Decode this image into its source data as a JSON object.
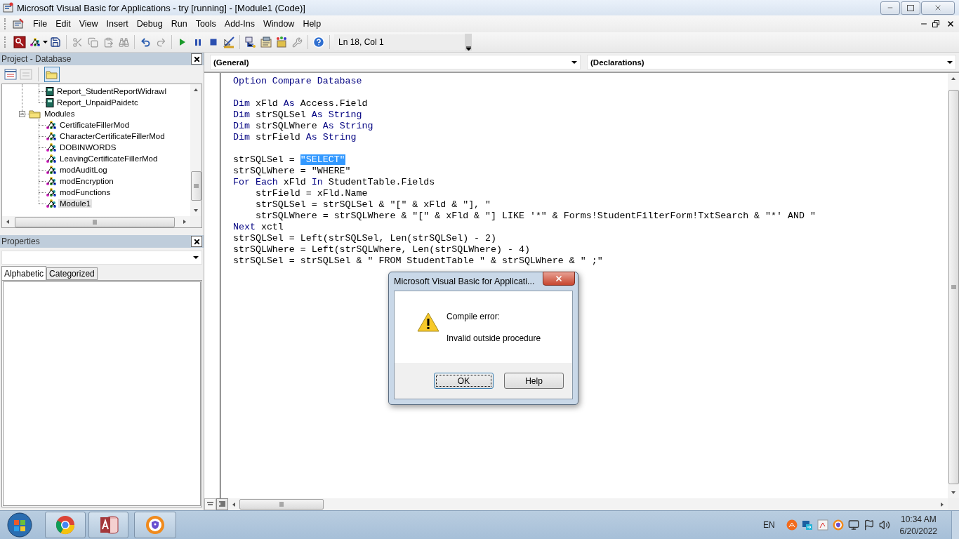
{
  "window": {
    "title": "Microsoft Visual Basic for Applications - try [running] - [Module1 (Code)]"
  },
  "menu": [
    "File",
    "Edit",
    "View",
    "Insert",
    "Debug",
    "Run",
    "Tools",
    "Add-Ins",
    "Window",
    "Help"
  ],
  "toolbar": {
    "position": "Ln 18, Col 1"
  },
  "project_panel": {
    "title": "Project - Database",
    "tree": [
      {
        "kind": "hidden_folder",
        "children": [
          {
            "label": "Report_StudentReportWidrawl",
            "kind": "report",
            "selected": false
          },
          {
            "label": "Report_UnpaidPaidetc",
            "kind": "report",
            "selected": false
          }
        ]
      },
      {
        "label": "Modules",
        "kind": "folder",
        "expanded": true,
        "selected": false,
        "children": [
          {
            "label": "CertificateFillerMod",
            "kind": "module",
            "selected": false
          },
          {
            "label": "CharacterCertificateFillerMod",
            "kind": "module",
            "selected": false
          },
          {
            "label": "DOBINWORDS",
            "kind": "module",
            "selected": false
          },
          {
            "label": "LeavingCertificateFillerMod",
            "kind": "module",
            "selected": false
          },
          {
            "label": "modAuditLog",
            "kind": "module",
            "selected": false
          },
          {
            "label": "modEncryption",
            "kind": "module",
            "selected": false
          },
          {
            "label": "modFunctions",
            "kind": "module",
            "selected": false
          },
          {
            "label": "Module1",
            "kind": "module",
            "selected": true
          }
        ]
      }
    ]
  },
  "properties_panel": {
    "title": "Properties",
    "tabs": [
      {
        "label": "Alphabetic",
        "selected": true
      },
      {
        "label": "Categorized",
        "selected": false
      }
    ]
  },
  "code_window": {
    "object_combo": "(General)",
    "procedure_combo": "(Declarations)",
    "lines": [
      {
        "kind": "code",
        "segments": [
          {
            "text": "Option Compare Database",
            "kind": "keyword"
          }
        ]
      },
      {
        "kind": "blank"
      },
      {
        "kind": "code",
        "segments": [
          {
            "text": "Dim",
            "kind": "keyword"
          },
          {
            "text": " xFld ",
            "kind": "plain"
          },
          {
            "text": "As",
            "kind": "keyword"
          },
          {
            "text": " Access.Field",
            "kind": "plain"
          }
        ]
      },
      {
        "kind": "code",
        "segments": [
          {
            "text": "Dim",
            "kind": "keyword"
          },
          {
            "text": " strSQLSel ",
            "kind": "plain"
          },
          {
            "text": "As String",
            "kind": "keyword"
          }
        ]
      },
      {
        "kind": "code",
        "segments": [
          {
            "text": "Dim",
            "kind": "keyword"
          },
          {
            "text": " strSQLWhere ",
            "kind": "plain"
          },
          {
            "text": "As String",
            "kind": "keyword"
          }
        ]
      },
      {
        "kind": "code",
        "segments": [
          {
            "text": "Dim",
            "kind": "keyword"
          },
          {
            "text": " strField ",
            "kind": "plain"
          },
          {
            "text": "As String",
            "kind": "keyword"
          }
        ]
      },
      {
        "kind": "blank"
      },
      {
        "kind": "code",
        "segments": [
          {
            "text": "strSQLSel = ",
            "kind": "plain"
          },
          {
            "text": "\"SELECT\"",
            "kind": "selected"
          }
        ]
      },
      {
        "kind": "code",
        "segments": [
          {
            "text": "strSQLWhere = \"WHERE\"",
            "kind": "plain"
          }
        ]
      },
      {
        "kind": "code",
        "segments": [
          {
            "text": "For Each",
            "kind": "keyword"
          },
          {
            "text": " xFld ",
            "kind": "plain"
          },
          {
            "text": "In",
            "kind": "keyword"
          },
          {
            "text": " StudentTable.Fields",
            "kind": "plain"
          }
        ]
      },
      {
        "kind": "code",
        "segments": [
          {
            "text": "    strField = xFld.Name",
            "kind": "plain"
          }
        ]
      },
      {
        "kind": "code",
        "segments": [
          {
            "text": "    strSQLSel = strSQLSel & \"[\" & xFld & \"], \"",
            "kind": "plain"
          }
        ]
      },
      {
        "kind": "code",
        "segments": [
          {
            "text": "    strSQLWhere = strSQLWhere & \"[\" & xFld & \"] LIKE '*\" & Forms!StudentFilterForm!TxtSearch & \"*' AND \"",
            "kind": "plain"
          }
        ]
      },
      {
        "kind": "code",
        "segments": [
          {
            "text": "Next",
            "kind": "keyword"
          },
          {
            "text": " xctl",
            "kind": "plain"
          }
        ]
      },
      {
        "kind": "code",
        "segments": [
          {
            "text": "strSQLSel = Left(strSQLSel, Len(strSQLSel) - 2)",
            "kind": "plain"
          }
        ]
      },
      {
        "kind": "code",
        "segments": [
          {
            "text": "strSQLWhere = Left(strSQLWhere, Len(strSQLWhere) - 4)",
            "kind": "plain"
          }
        ]
      },
      {
        "kind": "code",
        "segments": [
          {
            "text": "strSQLSel = strSQLSel & \" FROM StudentTable \" & strSQLWhere & \" ;\"",
            "kind": "plain"
          }
        ]
      }
    ]
  },
  "dialog": {
    "title": "Microsoft Visual Basic for Applicati...",
    "heading": "Compile error:",
    "message": "Invalid outside procedure",
    "buttons": [
      {
        "label": "OK",
        "selected": true
      },
      {
        "label": "Help",
        "selected": false
      }
    ]
  },
  "taskbar": {
    "language": "EN",
    "time": "10:34 AM",
    "date": "6/20/2022"
  }
}
